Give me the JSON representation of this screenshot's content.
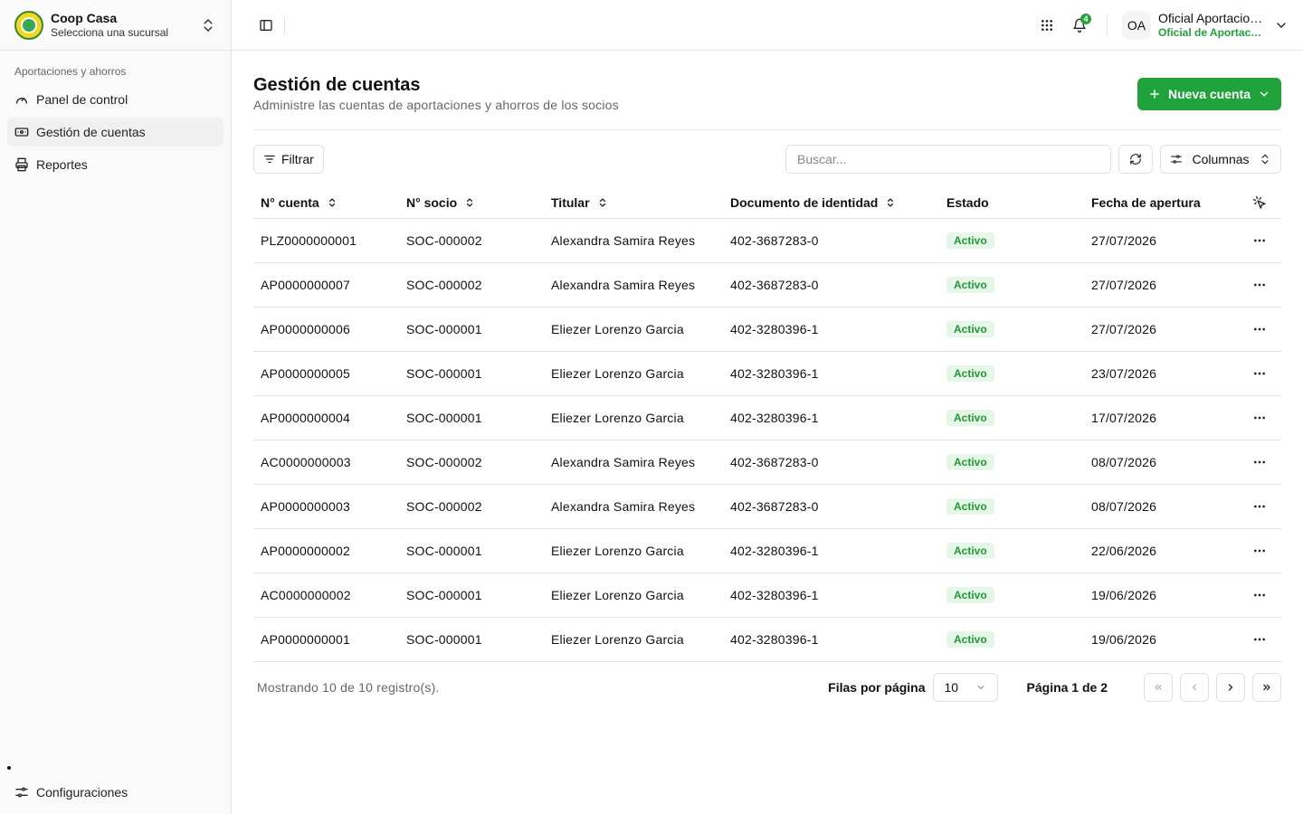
{
  "brand": {
    "name": "Coop Casa",
    "subtitle": "Selecciona una sucursal"
  },
  "sidebar": {
    "group_label": "Aportaciones y ahorros",
    "items": [
      {
        "label": "Panel de control",
        "icon": "gauge-icon"
      },
      {
        "label": "Gestión de cuentas",
        "icon": "wallet-icon",
        "active": true
      },
      {
        "label": "Reportes",
        "icon": "printer-icon"
      }
    ],
    "settings_label": "Configuraciones"
  },
  "topbar": {
    "notifications_count": "4",
    "user_initials": "OA",
    "user_name": "Oficial Aportaciones",
    "user_role": "Oficial de Aportaciones"
  },
  "page": {
    "title": "Gestión de cuentas",
    "subtitle": "Administre las cuentas de aportaciones y ahorros de los socios",
    "new_button": "Nueva cuenta"
  },
  "toolbar": {
    "filter_label": "Filtrar",
    "search_placeholder": "Buscar...",
    "columns_label": "Columnas"
  },
  "table": {
    "headers": [
      "N° cuenta",
      "N° socio",
      "Titular",
      "Documento de identidad",
      "Estado",
      "Fecha de apertura"
    ],
    "rows": [
      [
        "PLZ0000000001",
        "SOC-000002",
        "Alexandra Samira Reyes",
        "402-3687283-0",
        "Activo",
        "27/07/2026"
      ],
      [
        "AP0000000007",
        "SOC-000002",
        "Alexandra Samira Reyes",
        "402-3687283-0",
        "Activo",
        "27/07/2026"
      ],
      [
        "AP0000000006",
        "SOC-000001",
        "Eliezer Lorenzo Garcia",
        "402-3280396-1",
        "Activo",
        "27/07/2026"
      ],
      [
        "AP0000000005",
        "SOC-000001",
        "Eliezer Lorenzo Garcia",
        "402-3280396-1",
        "Activo",
        "23/07/2026"
      ],
      [
        "AP0000000004",
        "SOC-000001",
        "Eliezer Lorenzo Garcia",
        "402-3280396-1",
        "Activo",
        "17/07/2026"
      ],
      [
        "AC0000000003",
        "SOC-000002",
        "Alexandra Samira Reyes",
        "402-3687283-0",
        "Activo",
        "08/07/2026"
      ],
      [
        "AP0000000003",
        "SOC-000002",
        "Alexandra Samira Reyes",
        "402-3687283-0",
        "Activo",
        "08/07/2026"
      ],
      [
        "AP0000000002",
        "SOC-000001",
        "Eliezer Lorenzo Garcia",
        "402-3280396-1",
        "Activo",
        "22/06/2026"
      ],
      [
        "AC0000000002",
        "SOC-000001",
        "Eliezer Lorenzo Garcia",
        "402-3280396-1",
        "Activo",
        "19/06/2026"
      ],
      [
        "AP0000000001",
        "SOC-000001",
        "Eliezer Lorenzo Garcia",
        "402-3280396-1",
        "Activo",
        "19/06/2026"
      ]
    ]
  },
  "footer": {
    "showing": "Mostrando 10 de 10 registro(s).",
    "rows_per_page_label": "Filas por página",
    "rows_per_page_value": "10",
    "page_info": "Página 1 de 2"
  },
  "colors": {
    "accent": "#1fa33a",
    "badge_bg": "#e6f6e8",
    "badge_text": "#1f9a36"
  }
}
